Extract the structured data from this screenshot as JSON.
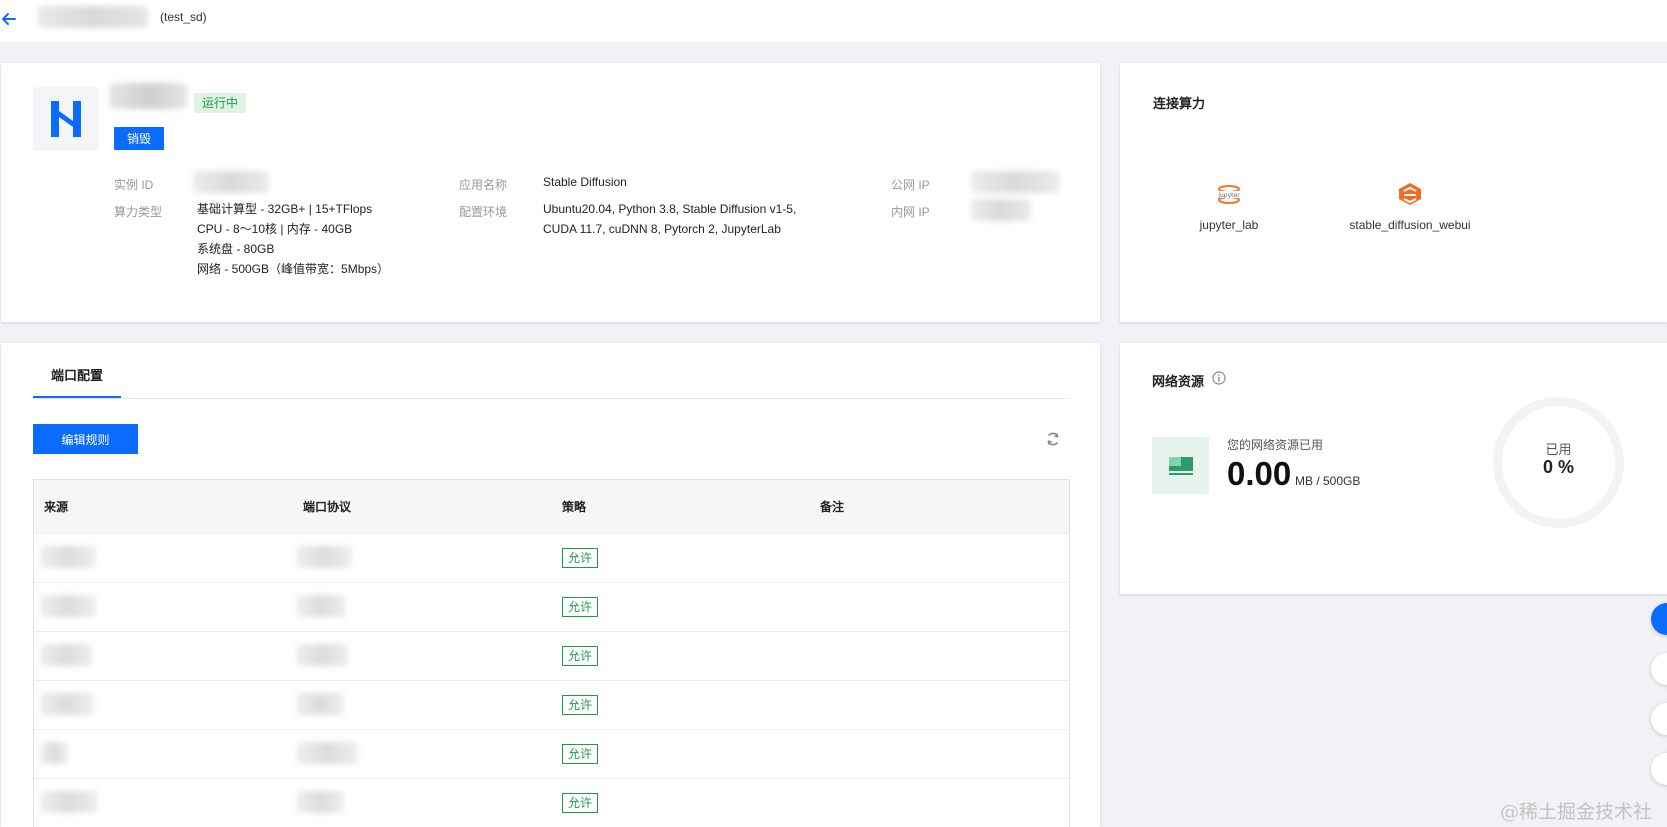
{
  "header": {
    "subtitle": "(test_sd)"
  },
  "instance": {
    "status": "运行中",
    "destroy_label": "销毁",
    "labels": {
      "instance_id": "实例 ID",
      "compute_type": "算力类型",
      "app_name": "应用名称",
      "env": "配置环境",
      "public_ip": "公网 IP",
      "private_ip": "内网 IP"
    },
    "compute_lines": [
      "基础计算型 - 32GB+ | 15+TFlops",
      "CPU - 8～10核 | 内存 - 40GB",
      "系统盘 - 80GB",
      "网络 - 500GB（峰值带宽：5Mbps）"
    ],
    "app_name": "Stable Diffusion",
    "env_lines": [
      "Ubuntu20.04, Python 3.8, Stable Diffusion v1-5,",
      "CUDA 11.7, cuDNN 8, Pytorch 2, JupyterLab"
    ]
  },
  "connect": {
    "title": "连接算力",
    "items": [
      {
        "label": "jupyter_lab",
        "icon": "jupyter-icon"
      },
      {
        "label": "stable_diffusion_webui",
        "icon": "stable-diffusion-icon"
      }
    ]
  },
  "ports": {
    "tab_label": "端口配置",
    "edit_label": "编辑规则",
    "columns": [
      "来源",
      "端口协议",
      "策略",
      "备注"
    ],
    "rows": [
      {
        "policy": "允许"
      },
      {
        "policy": "允许"
      },
      {
        "policy": "允许"
      },
      {
        "policy": "允许"
      },
      {
        "policy": "允许"
      },
      {
        "policy": "允许"
      }
    ]
  },
  "network": {
    "title": "网络资源",
    "used_label": "您的网络资源已用",
    "used_value": "0.00",
    "unit": "MB / 500GB",
    "ring_label": "已用",
    "ring_value": "0 %",
    "used_fraction": 0
  },
  "watermark": "@稀土掘金技术社区",
  "colors": {
    "primary": "#0a6cff",
    "success": "#1d9a4a",
    "jupyter": "#f37626",
    "sd": "#f36b21"
  }
}
